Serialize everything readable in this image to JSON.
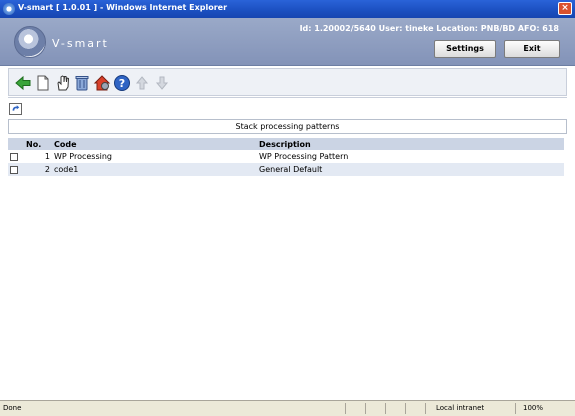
{
  "window": {
    "title": "V-smart [ 1.0.01 ] - Windows Internet Explorer"
  },
  "header": {
    "brand": "V-smart",
    "info": "Id: 1.20002/5640   User: tineke   Location: PNB/BD   AFO: 618",
    "settings_label": "Settings",
    "exit_label": "Exit"
  },
  "toolbar": {
    "icons": [
      "back-arrow-icon",
      "new-document-icon",
      "hand-select-icon",
      "trash-icon",
      "house-gear-icon",
      "help-icon",
      "arrow-up-icon",
      "arrow-down-icon"
    ]
  },
  "section": {
    "title": "Stack processing patterns"
  },
  "table": {
    "headers": {
      "no": "No.",
      "code": "Code",
      "description": "Description"
    },
    "rows": [
      {
        "no": "1",
        "code": "WP Processing",
        "description": "WP Processing Pattern"
      },
      {
        "no": "2",
        "code": "code1",
        "description": "General Default"
      }
    ]
  },
  "statusbar": {
    "status": "Done",
    "zone": "Local intranet",
    "zoom": "100%"
  },
  "colors": {
    "titlebar": "#1b4fc0",
    "header": "#8d9dbe",
    "row_alt": "#e3e9f3",
    "table_header": "#cbd4e4"
  }
}
